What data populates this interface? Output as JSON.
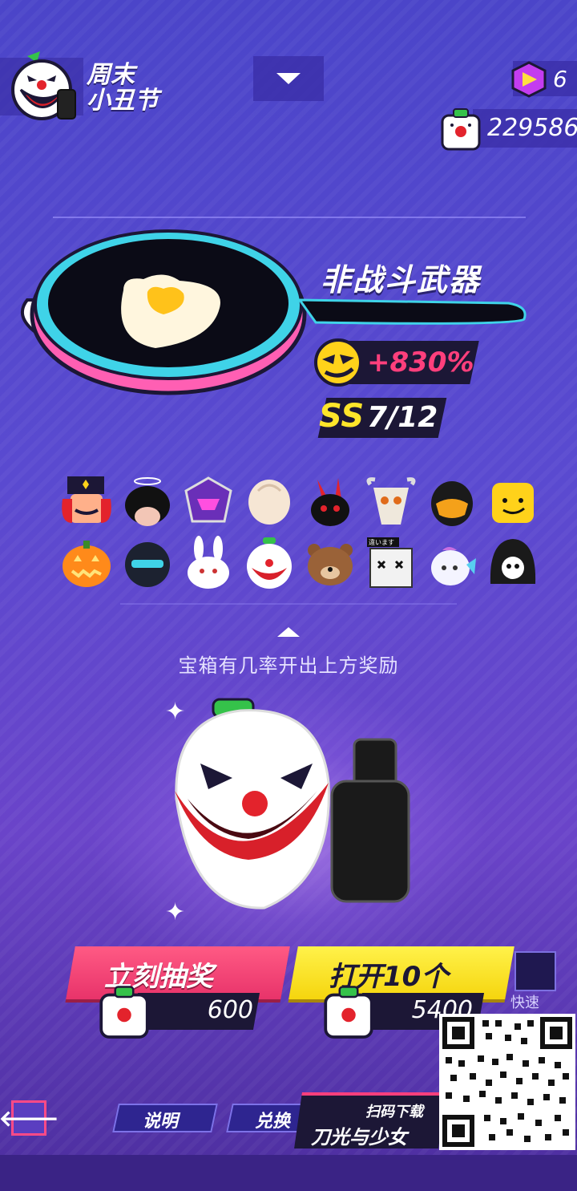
{
  "header": {
    "event_title": "周末\n小丑节",
    "gems": "6",
    "coins": "229586"
  },
  "weapon": {
    "name": "非战斗武器",
    "bonus": "+830%",
    "rank_label": "SS",
    "rank_progress": "7/12"
  },
  "rewards": {
    "heads": [
      "nutcracker-head-icon",
      "black-hair-halo-head-icon",
      "purple-mecha-head-icon",
      "blonde-hair-head-icon",
      "black-bunny-head-icon",
      "skull-mask-head-icon",
      "black-helmet-head-icon",
      "yellow-block-head-icon",
      "pumpkin-head-icon",
      "knight-helmet-head-icon",
      "white-bunny-head-icon",
      "clown-head-icon",
      "bear-head-icon",
      "box-head-icon",
      "white-fish-head-icon",
      "reaper-head-icon"
    ],
    "box_label": "違います",
    "hint": "宝箱有几率开出上方奖励"
  },
  "actions": {
    "draw_now": "立刻抽奖",
    "draw_now_cost": "600",
    "open_ten": "打开10个",
    "open_ten_cost": "5400",
    "fast": "快速"
  },
  "footer": {
    "back_symbol": "🡐",
    "info": "说明",
    "exchange": "兑换",
    "promo_small": "扫码下载",
    "promo_big": "刀光与少女"
  },
  "colors": {
    "accent_red": "#e8336a",
    "accent_yellow": "#f5d50e",
    "bonus_pink": "#ff3f7c",
    "background": "#4b45c9"
  }
}
